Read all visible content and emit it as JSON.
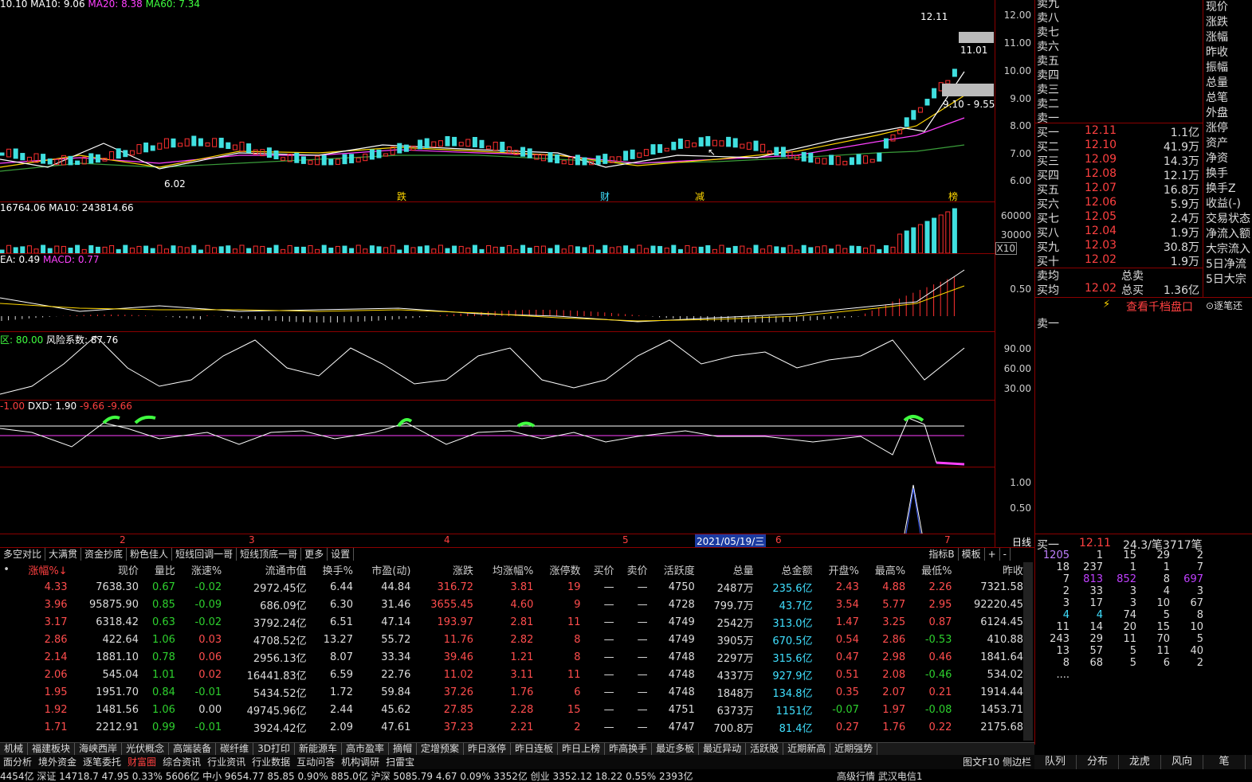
{
  "main_chart": {
    "ma_label": "10.10 MA10: 9.06",
    "ma20": "MA20: 8.38",
    "ma60": "MA60: 7.34",
    "high_label": "12.11",
    "mid_label": "11.01",
    "low_label": "9.10 - 9.55",
    "min_label": "6.02",
    "y_ticks": [
      "12.00",
      "11.00",
      "10.00",
      "9.00",
      "8.00",
      "7.00",
      "6.00"
    ],
    "markers": [
      "跌",
      "财",
      "减",
      "榜"
    ]
  },
  "vol_chart": {
    "label": "16764.06 MA10: 243814.66",
    "y_ticks": [
      "60000",
      "30000"
    ],
    "unit": "X10"
  },
  "macd_chart": {
    "label": "EA: 0.49",
    "macd": "MACD: 0.77",
    "y_ticks": [
      "0.50"
    ]
  },
  "risk_chart": {
    "label": "区: 80.00",
    "risk": "风险系数: 87.76",
    "y_ticks": [
      "90.00",
      "60.00",
      "30.00"
    ]
  },
  "dxd_chart": {
    "label": "-1.00",
    "dxd": "DXD: 1.90",
    "v1": "-9.66",
    "v2": "-9.66"
  },
  "sig_chart": {
    "y_ticks": [
      "1.00",
      "0.50"
    ]
  },
  "time_axis": {
    "labels": [
      "2",
      "3",
      "4",
      "5",
      "2021/05/19/三",
      "6",
      "7"
    ],
    "period": "日线"
  },
  "order_book": {
    "sells": [
      {
        "n": "卖九"
      },
      {
        "n": "卖八"
      },
      {
        "n": "卖七"
      },
      {
        "n": "卖六"
      },
      {
        "n": "卖五"
      },
      {
        "n": "卖四"
      },
      {
        "n": "卖三"
      },
      {
        "n": "卖二"
      },
      {
        "n": "卖一"
      }
    ],
    "buys": [
      {
        "n": "买一",
        "p": "12.11",
        "v": "1.1亿"
      },
      {
        "n": "买二",
        "p": "12.10",
        "v": "41.9万"
      },
      {
        "n": "买三",
        "p": "12.09",
        "v": "14.3万"
      },
      {
        "n": "买四",
        "p": "12.08",
        "v": "12.1万"
      },
      {
        "n": "买五",
        "p": "12.07",
        "v": "16.8万"
      },
      {
        "n": "买六",
        "p": "12.06",
        "v": "5.9万"
      },
      {
        "n": "买七",
        "p": "12.05",
        "v": "2.4万"
      },
      {
        "n": "买八",
        "p": "12.04",
        "v": "1.9万"
      },
      {
        "n": "买九",
        "p": "12.03",
        "v": "30.8万"
      },
      {
        "n": "买十",
        "p": "12.02",
        "v": "1.9万"
      }
    ],
    "avg_sell": "卖均",
    "avg_buy": "买均",
    "avg_buy_p": "12.02",
    "total_sell": "总卖",
    "total_buy": "总买",
    "total_buy_v": "1.36亿",
    "link": "查看千档盘口",
    "side_link": "逐笔还",
    "sell1_label": "卖一"
  },
  "side_labels": [
    "现价",
    "涨跌",
    "涨幅",
    "昨收",
    "振幅",
    "总量",
    "总笔",
    "外盘",
    "涨停",
    "资产",
    "净资",
    "换手",
    "换手Z",
    "收益(-)",
    "交易状态",
    "净流入额",
    "大宗流入",
    "5日净流",
    "5日大宗"
  ],
  "level2": {
    "head": [
      "买一",
      "12.11",
      "24.3/笔",
      "3717笔"
    ],
    "rows": [
      [
        "1205",
        "1",
        "15",
        "29",
        "2"
      ],
      [
        "18",
        "237",
        "1",
        "1",
        "7"
      ],
      [
        "7",
        "813",
        "852",
        "8",
        "697"
      ],
      [
        "2",
        "33",
        "3",
        "4",
        "3"
      ],
      [
        "3",
        "17",
        "3",
        "10",
        "67"
      ],
      [
        "4",
        "4",
        "74",
        "5",
        "8"
      ],
      [
        "11",
        "14",
        "20",
        "15",
        "10"
      ],
      [
        "243",
        "29",
        "11",
        "70",
        "5"
      ],
      [
        "13",
        "57",
        "5",
        "11",
        "40"
      ],
      [
        "8",
        "68",
        "5",
        "6",
        "2"
      ],
      [
        "....",
        "",
        "",
        "",
        ""
      ]
    ]
  },
  "tabs": [
    "多空对比",
    "大满贯",
    "资金抄底",
    "粉色佳人",
    "短线回调一哥",
    "短线顶底一哥",
    "更多",
    "设置"
  ],
  "tabs_right": [
    "指标B",
    "模板",
    "+",
    "-"
  ],
  "table": {
    "headers": [
      "•",
      "涨幅%↓",
      "现价",
      "量比",
      "涨速%",
      "流通市值",
      "换手%",
      "市盈(动)",
      "涨跌",
      "均涨幅%",
      "涨停数",
      "买价",
      "卖价",
      "活跃度",
      "总量",
      "总金额",
      "开盘%",
      "最高%",
      "最低%",
      "昨收"
    ],
    "rows": [
      [
        "4.33",
        "7638.30",
        "0.67",
        "-0.02",
        "2972.45亿",
        "6.44",
        "44.84",
        "316.72",
        "3.81",
        "19",
        "—",
        "—",
        "4750",
        "2487万",
        "235.6亿",
        "2.43",
        "4.88",
        "2.26",
        "7321.58"
      ],
      [
        "3.96",
        "95875.90",
        "0.85",
        "-0.09",
        "686.09亿",
        "6.30",
        "31.46",
        "3655.45",
        "4.60",
        "9",
        "—",
        "—",
        "4728",
        "799.7万",
        "43.7亿",
        "3.54",
        "5.77",
        "2.95",
        "92220.45"
      ],
      [
        "3.17",
        "6318.42",
        "0.63",
        "-0.02",
        "3792.24亿",
        "6.51",
        "47.14",
        "193.97",
        "2.81",
        "11",
        "—",
        "—",
        "4749",
        "2542万",
        "313.0亿",
        "1.47",
        "3.25",
        "0.87",
        "6124.45"
      ],
      [
        "2.86",
        "422.64",
        "1.06",
        "0.03",
        "4708.52亿",
        "13.27",
        "55.72",
        "11.76",
        "2.82",
        "8",
        "—",
        "—",
        "4749",
        "3905万",
        "670.5亿",
        "0.54",
        "2.86",
        "-0.53",
        "410.88"
      ],
      [
        "2.14",
        "1881.10",
        "0.78",
        "0.06",
        "2956.13亿",
        "8.07",
        "33.34",
        "39.46",
        "1.21",
        "8",
        "—",
        "—",
        "4748",
        "2297万",
        "315.6亿",
        "0.47",
        "2.98",
        "0.46",
        "1841.64"
      ],
      [
        "2.06",
        "545.04",
        "1.01",
        "0.02",
        "16441.83亿",
        "6.59",
        "22.76",
        "11.02",
        "3.11",
        "11",
        "—",
        "—",
        "4748",
        "4337万",
        "927.9亿",
        "0.51",
        "2.08",
        "-0.46",
        "534.02"
      ],
      [
        "1.95",
        "1951.70",
        "0.84",
        "-0.01",
        "5434.52亿",
        "1.72",
        "59.84",
        "37.26",
        "1.76",
        "6",
        "—",
        "—",
        "4748",
        "1848万",
        "134.8亿",
        "0.35",
        "2.07",
        "0.21",
        "1914.44"
      ],
      [
        "1.92",
        "1481.56",
        "1.06",
        "0.00",
        "49745.96亿",
        "2.44",
        "45.62",
        "27.85",
        "2.28",
        "15",
        "—",
        "—",
        "4751",
        "6373万",
        "1151亿",
        "-0.07",
        "1.97",
        "-0.08",
        "1453.71"
      ],
      [
        "1.71",
        "2212.91",
        "0.99",
        "-0.01",
        "3924.42亿",
        "2.09",
        "47.61",
        "37.23",
        "2.21",
        "2",
        "—",
        "—",
        "4747",
        "700.8万",
        "81.4亿",
        "0.27",
        "1.76",
        "0.22",
        "2175.68"
      ]
    ]
  },
  "sectors": [
    "机械",
    "福建板块",
    "海峡西岸",
    "光伏概念",
    "高端装备",
    "碳纤维",
    "3D打印",
    "新能源车",
    "高市盈率",
    "摘帽",
    "定增预案",
    "昨日涨停",
    "昨日连板",
    "昨日上榜",
    "昨高换手",
    "最近多板",
    "最近异动",
    "活跃股",
    "近期新高",
    "近期强势"
  ],
  "status": [
    "面分析",
    "境外资金",
    "逐笔委托",
    "财富圈",
    "综合资讯",
    "行业资讯",
    "行业数据",
    "互动问答",
    "机构调研",
    "扫雷宝"
  ],
  "status_right": [
    "图文F10",
    "侧边栏"
  ],
  "right_tabs": [
    "队列",
    "分布",
    "龙虎",
    "风向",
    "笔"
  ],
  "ticker": "4454亿  深证 14718.7  47.95  0.33%  5606亿  中小 9654.77  85.85  0.90%  885.0亿  沪深 5085.79  4.67  0.09%  3352亿  创业 3352.12  18.22  0.55%  2393亿",
  "ticker_right": "高级行情  武汉电信1"
}
